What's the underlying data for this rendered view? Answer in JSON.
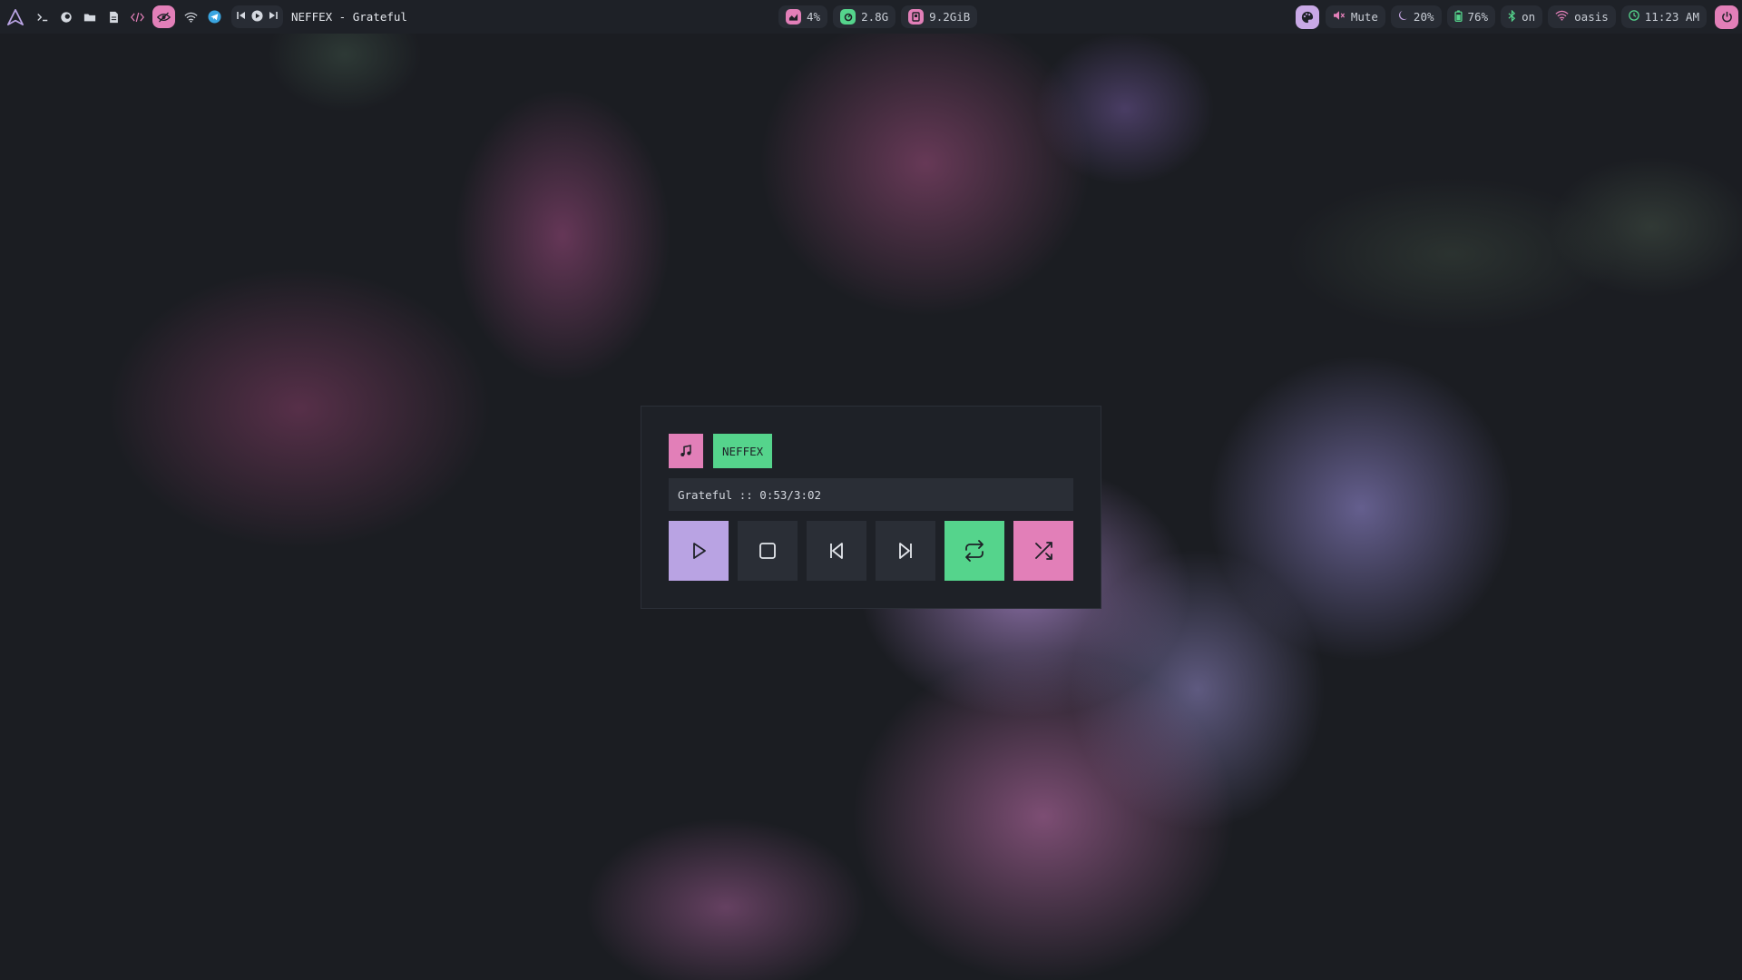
{
  "topbar": {
    "now_playing": "NEFFEX - Grateful",
    "cpu": "4%",
    "temp": "2.8G",
    "memory": "9.2GiB",
    "volume": "Mute",
    "brightness": "20%",
    "battery": "76%",
    "bluetooth": "on",
    "wifi": "oasis",
    "clock": "11:23 AM"
  },
  "player": {
    "artist": "NEFFEX",
    "track_info": "Grateful :: 0:53/3:02"
  },
  "colors": {
    "pink": "#e27fb8",
    "green": "#55d48c",
    "purple": "#b9a3e3",
    "bar_bg": "#1e2127",
    "chip_bg": "#282c34"
  }
}
